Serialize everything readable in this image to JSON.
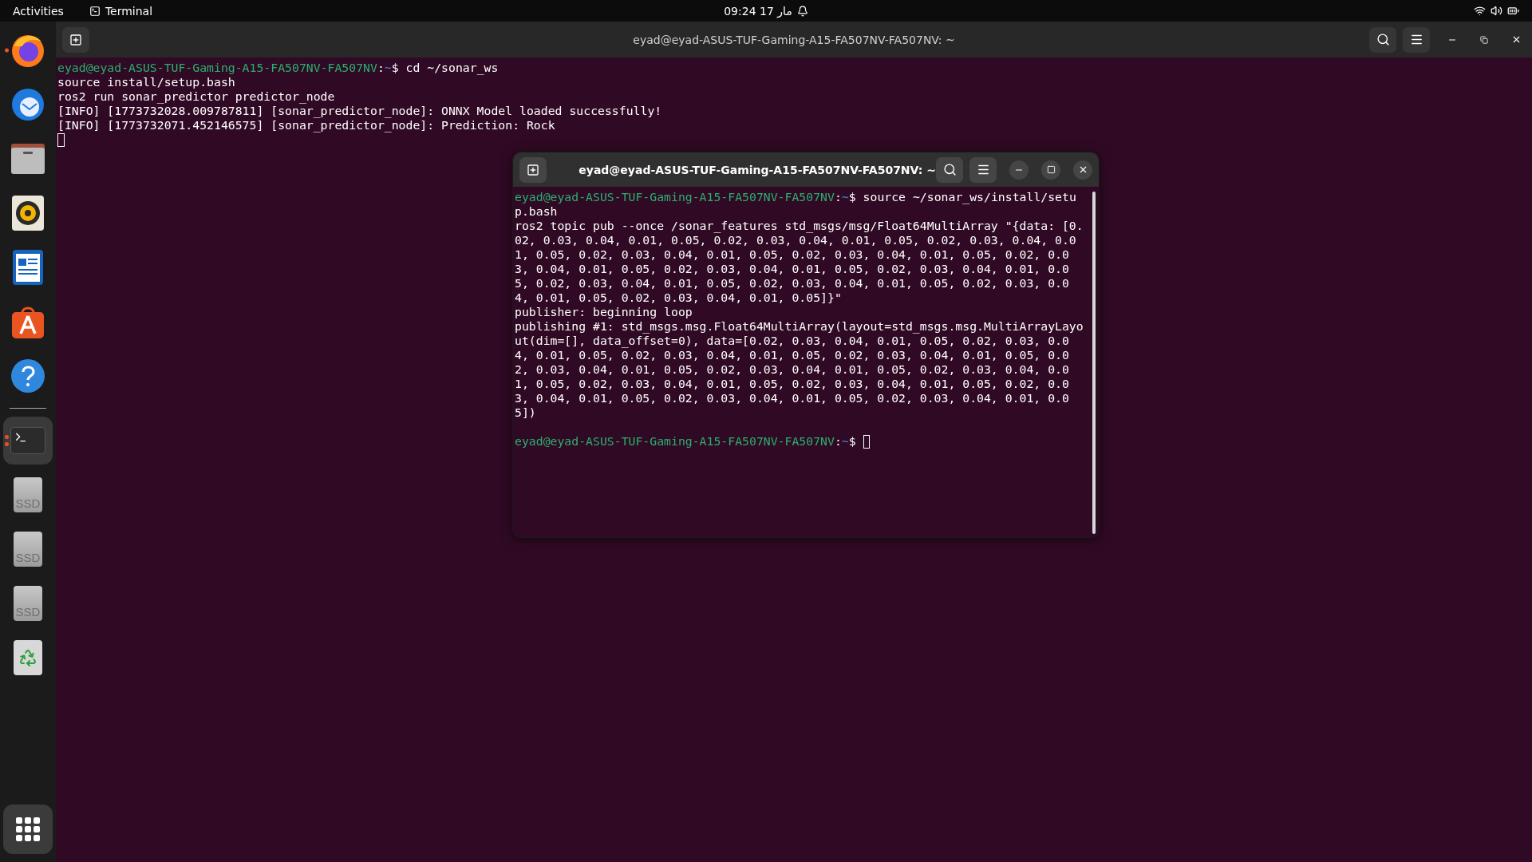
{
  "top_bar": {
    "activities": "Activities",
    "app_menu": "Terminal",
    "clock": "09:24",
    "date": "17 مار"
  },
  "dock": {
    "apps": [
      {
        "kind": "firefox",
        "running": true,
        "multiple_windows": false,
        "focused": false
      },
      {
        "kind": "mail",
        "running": false,
        "multiple_windows": false,
        "focused": false
      },
      {
        "kind": "files",
        "running": false,
        "multiple_windows": false,
        "focused": false
      },
      {
        "kind": "music",
        "running": false,
        "multiple_windows": false,
        "focused": false
      },
      {
        "kind": "writer",
        "running": false,
        "multiple_windows": false,
        "focused": false
      },
      {
        "kind": "store",
        "running": false,
        "multiple_windows": false,
        "focused": false
      },
      {
        "kind": "help",
        "running": false,
        "multiple_windows": false,
        "focused": false
      },
      {
        "kind": "separator"
      },
      {
        "kind": "terminal",
        "running": true,
        "multiple_windows": true,
        "focused": true
      },
      {
        "kind": "drive",
        "label": "SSD",
        "running": false,
        "multiple_windows": false,
        "focused": false
      },
      {
        "kind": "drive",
        "label": "SSD",
        "running": false,
        "multiple_windows": false,
        "focused": false
      },
      {
        "kind": "drive",
        "label": "SSD",
        "running": false,
        "multiple_windows": false,
        "focused": false
      },
      {
        "kind": "trash",
        "running": false,
        "multiple_windows": false,
        "focused": false
      }
    ]
  },
  "windows": [
    {
      "title": "eyad@eyad-ASUS-TUF-Gaming-A15-FA507NV-FA507NV: ~",
      "focused": false,
      "maximized": true,
      "lines": [
        {
          "kind": "command",
          "user_host": "eyad@eyad-ASUS-TUF-Gaming-A15-FA507NV-FA507NV",
          "separator": ":",
          "path": "~",
          "symbol": "$",
          "command": "cd ~/sonar_ws"
        },
        {
          "kind": "output",
          "text": "source install/setup.bash"
        },
        {
          "kind": "output",
          "text": "ros2 run sonar_predictor predictor_node"
        },
        {
          "kind": "output",
          "text": "[INFO] [1773732028.009787811] [sonar_predictor_node]: ONNX Model loaded successfully!"
        },
        {
          "kind": "output",
          "text": "[INFO] [1773732071.452146575] [sonar_predictor_node]: Prediction: Rock"
        },
        {
          "kind": "empty"
        }
      ]
    },
    {
      "title": "eyad@eyad-ASUS-TUF-Gaming-A15-FA507NV-FA507NV: ~",
      "focused": true,
      "maximized": false,
      "lines": [
        {
          "kind": "command",
          "user_host": "eyad@eyad-ASUS-TUF-Gaming-A15-FA507NV-FA507NV",
          "separator": ":",
          "path": "~",
          "symbol": "$",
          "command": "source ~/sonar_ws/install/setup.bash"
        },
        {
          "kind": "output",
          "text": "ros2 topic pub --once /sonar_features std_msgs/msg/Float64MultiArray \"{data: [0.02, 0.03, 0.04, 0.01, 0.05, 0.02, 0.03, 0.04, 0.01, 0.05, 0.02, 0.03, 0.04, 0.01, 0.05, 0.02, 0.03, 0.04, 0.01, 0.05, 0.02, 0.03, 0.04, 0.01, 0.05, 0.02, 0.03, 0.04, 0.01, 0.05, 0.02, 0.03, 0.04, 0.01, 0.05, 0.02, 0.03, 0.04, 0.01, 0.05, 0.02, 0.03, 0.04, 0.01, 0.05, 0.02, 0.03, 0.04, 0.01, 0.05, 0.02, 0.03, 0.04, 0.01, 0.05, 0.02, 0.03, 0.04, 0.01, 0.05]}\""
        },
        {
          "kind": "output",
          "text": "publisher: beginning loop"
        },
        {
          "kind": "output",
          "text": "publishing #1: std_msgs.msg.Float64MultiArray(layout=std_msgs.msg.MultiArrayLayout(dim=[], data_offset=0), data=[0.02, 0.03, 0.04, 0.01, 0.05, 0.02, 0.03, 0.04, 0.01, 0.05, 0.02, 0.03, 0.04, 0.01, 0.05, 0.02, 0.03, 0.04, 0.01, 0.05, 0.02, 0.03, 0.04, 0.01, 0.05, 0.02, 0.03, 0.04, 0.01, 0.05, 0.02, 0.03, 0.04, 0.01, 0.05, 0.02, 0.03, 0.04, 0.01, 0.05, 0.02, 0.03, 0.04, 0.01, 0.05, 0.02, 0.03, 0.04, 0.01, 0.05, 0.02, 0.03, 0.04, 0.01, 0.05, 0.02, 0.03, 0.04, 0.01, 0.05])"
        },
        {
          "kind": "empty"
        },
        {
          "kind": "command",
          "user_host": "eyad@eyad-ASUS-TUF-Gaming-A15-FA507NV-FA507NV",
          "separator": ":",
          "path": "~",
          "symbol": "$"
        }
      ]
    }
  ]
}
